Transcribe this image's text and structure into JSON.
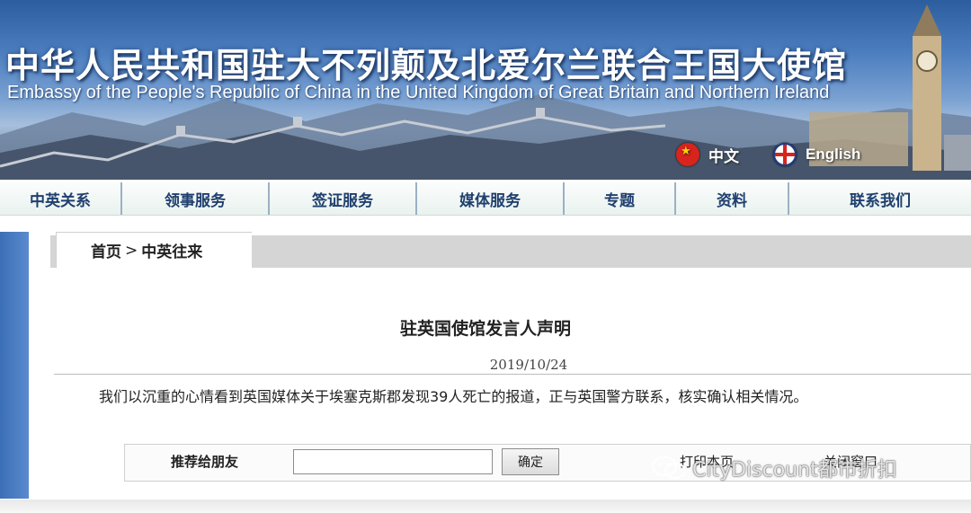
{
  "header": {
    "title_zh": "中华人民共和国驻大不列颠及北爱尔兰联合王国大使馆",
    "title_en": "Embassy of the People's Republic of China in the United Kingdom of Great Britain and Northern Ireland",
    "lang_zh": "中文",
    "lang_en": "English"
  },
  "nav": {
    "items": [
      {
        "label": "中英关系"
      },
      {
        "label": "领事服务"
      },
      {
        "label": "签证服务"
      },
      {
        "label": "媒体服务"
      },
      {
        "label": "专题"
      },
      {
        "label": "资料"
      },
      {
        "label": "联系我们"
      }
    ]
  },
  "breadcrumb": {
    "home": "首页",
    "separator": ">",
    "current": "中英往来"
  },
  "article": {
    "title": "驻英国使馆发言人声明",
    "date": "2019/10/24",
    "body": "我们以沉重的心情看到英国媒体关于埃塞克斯郡发现39人死亡的报道，正与英国警方联系，核实确认相关情况。"
  },
  "recommend": {
    "label": "推荐给朋友",
    "input_value": "",
    "confirm_label": "确定",
    "print_label": "打印本页",
    "close_label": "关闭窗口"
  },
  "watermark": {
    "text": "CityDiscount都市折扣"
  },
  "colors": {
    "banner_top": "#2c5d9e",
    "nav_text": "#1f3f6e",
    "sidebar": "#3b6fb5"
  }
}
